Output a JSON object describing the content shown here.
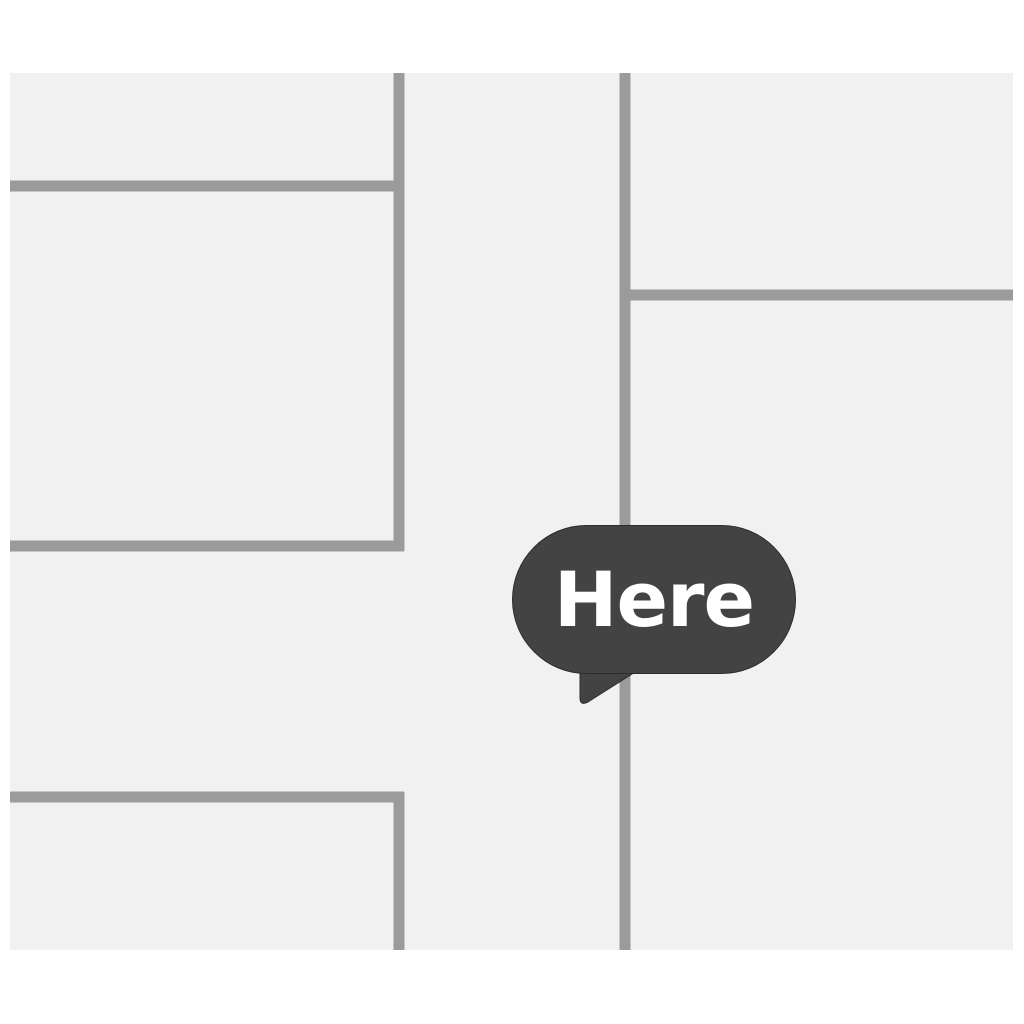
{
  "marker": {
    "label": "Here"
  },
  "colors": {
    "page_background": "#ffffff",
    "map_background": "#f1f1f1",
    "wall": "#9b9b9b",
    "marker_fill": "#434343",
    "marker_text": "#ffffff"
  }
}
